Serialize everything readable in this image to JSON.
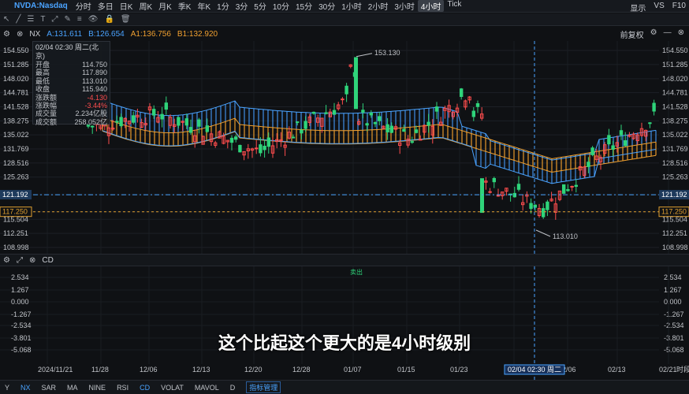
{
  "header": {
    "symbol": "NVDA:Nasdaq",
    "timeframes": [
      "分时",
      "多日",
      "日K",
      "周K",
      "月K",
      "季K",
      "年K",
      "1分",
      "3分",
      "5分",
      "10分",
      "15分",
      "30分",
      "1小时",
      "2小时",
      "3小时",
      "4小时",
      "Tick"
    ],
    "active_timeframe": "4小时",
    "right": [
      "显示",
      "VS",
      "F10"
    ]
  },
  "indicators": {
    "main": "NX",
    "a": "A:131.611",
    "b": "B:126.654",
    "a1": "A1:136.756",
    "b1": "B1:132.920",
    "right_label": "前复权",
    "colors": {
      "a": "#4aa3ff",
      "b": "#4aa3ff",
      "a1": "#f0a030",
      "b1": "#f0a030"
    }
  },
  "infobox": {
    "header": "02/04 02:30 周二(北京)",
    "rows": [
      {
        "k": "开盘",
        "v": "114.750"
      },
      {
        "k": "最高",
        "v": "117.890"
      },
      {
        "k": "最低",
        "v": "113.010"
      },
      {
        "k": "收盘",
        "v": "115.940"
      },
      {
        "k": "涨跌额",
        "v": "-4.130"
      },
      {
        "k": "涨跌幅",
        "v": "-3.44%"
      },
      {
        "k": "成交量",
        "v": "2.234亿股"
      },
      {
        "k": "成交额",
        "v": "258.052亿"
      }
    ]
  },
  "price_axis": [
    "154.550",
    "151.285",
    "148.020",
    "144.781",
    "141.528",
    "138.275",
    "135.022",
    "131.769",
    "128.516",
    "125.263",
    "121.192",
    "117.250",
    "115.504",
    "112.251",
    "108.998"
  ],
  "highlights": {
    "crosshair_price": "121.192",
    "dashed_price": "117.250",
    "high_label": "153.130",
    "low_label": "113.010"
  },
  "sub": {
    "name": "CD",
    "sell_label": "卖出",
    "axis": [
      "2.534",
      "1.267",
      "0.000",
      "-1.267",
      "-2.534",
      "-3.801",
      "-5.068"
    ]
  },
  "date_axis": [
    "2024/11/21",
    "11/28",
    "12/06",
    "12/13",
    "12/20",
    "12/28",
    "01/07",
    "01/15",
    "01/23",
    "01/31",
    "02/06",
    "02/13",
    "02/21"
  ],
  "crosshair_date": "02/04 02:30 周二",
  "time_label": "时段",
  "bottom_tabs": [
    "Y",
    "NX",
    "SAR",
    "MA",
    "NINE",
    "RSI",
    "CD",
    "VOLAT",
    "MAVOL",
    "D",
    "指标管理"
  ],
  "subtitle": "这个比起这个更大的是4小时级别",
  "colors": {
    "up": "#ff4d4d",
    "down": "#2fd47a",
    "blue_band": "#3f8fe6",
    "orange_band": "#e89a2c",
    "bg": "#0f1114"
  }
}
